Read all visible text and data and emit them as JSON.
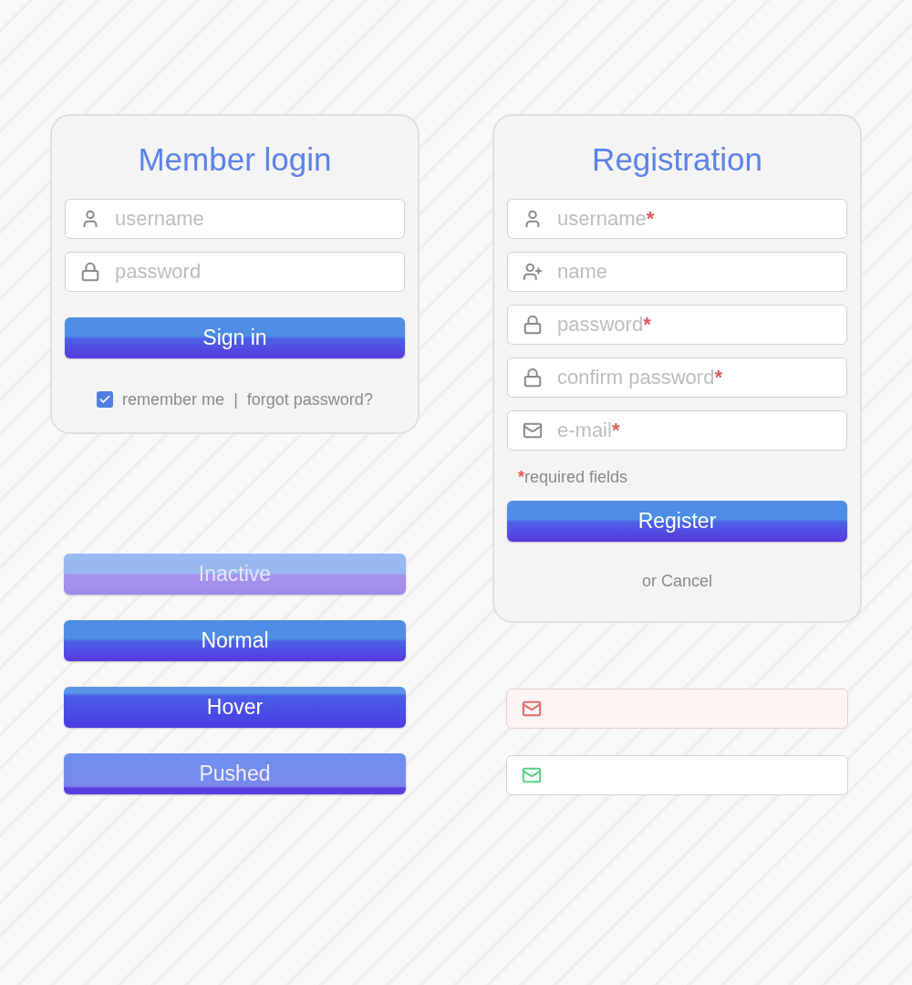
{
  "login": {
    "title": "Member login",
    "fields": [
      {
        "kind": "user",
        "placeholder": "username"
      },
      {
        "kind": "lock",
        "placeholder": "password"
      }
    ],
    "button": "Sign in",
    "remember": {
      "label": "remember me",
      "checked": true
    },
    "separator": "|",
    "forgot": "forgot password?"
  },
  "registration": {
    "title": "Registration",
    "required_mark": "*",
    "fields": [
      {
        "kind": "user",
        "placeholder": "username",
        "required": true
      },
      {
        "kind": "user-plus",
        "placeholder": "name",
        "required": false
      },
      {
        "kind": "lock",
        "placeholder": "password",
        "required": true
      },
      {
        "kind": "lock",
        "placeholder": "confirm password",
        "required": true
      },
      {
        "kind": "mail",
        "placeholder": "e-mail",
        "required": true
      }
    ],
    "required_note": "required fields",
    "button": "Register",
    "cancel": "or Cancel"
  },
  "button_states": [
    {
      "label": "Inactive",
      "kind": "inactive"
    },
    {
      "label": "Normal",
      "kind": "normal"
    },
    {
      "label": "Hover",
      "kind": "hover"
    },
    {
      "label": "Pushed",
      "kind": "pushed"
    }
  ],
  "validation_fields": [
    {
      "kind": "error"
    },
    {
      "kind": "valid"
    }
  ]
}
